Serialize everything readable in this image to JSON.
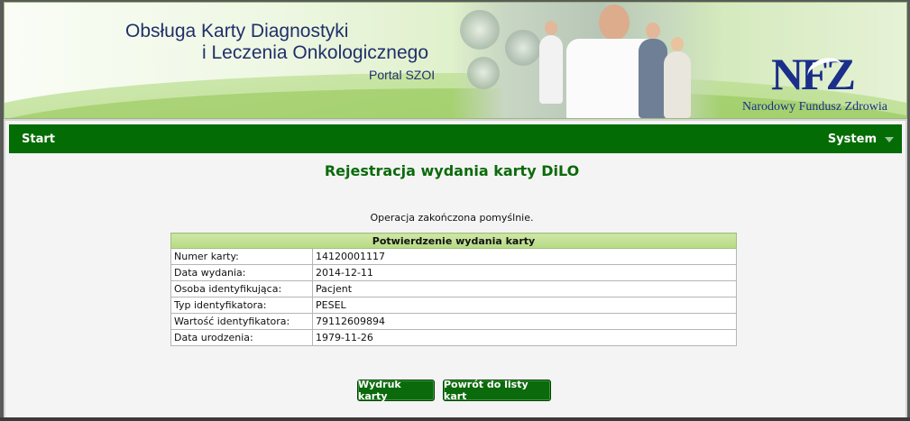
{
  "header": {
    "title_line1": "Obsługa Karty Diagnostyki",
    "title_line2": "i Leczenia Onkologicznego",
    "portal_label": "Portal SZOI",
    "logo_text": "NFZ",
    "org_name": "Narodowy Fundusz Zdrowia"
  },
  "nav": {
    "start_label": "Start",
    "system_label": "System",
    "system_icon": "caret-down-icon"
  },
  "main": {
    "title": "Rejestracja wydania karty DiLO",
    "status_message": "Operacja zakończona pomyślnie.",
    "table": {
      "header": "Potwierdzenie wydania karty",
      "rows": [
        {
          "label": "Numer karty:",
          "value": "14120001117"
        },
        {
          "label": "Data wydania:",
          "value": "2014-12-11"
        },
        {
          "label": "Osoba identyfikująca:",
          "value": "Pacjent"
        },
        {
          "label": "Typ identyfikatora:",
          "value": "PESEL"
        },
        {
          "label": "Wartość identyfikatora:",
          "value": "79112609894"
        },
        {
          "label": "Data urodzenia:",
          "value": "1979-11-26"
        }
      ]
    },
    "buttons": {
      "print_label": "Wydruk karty",
      "back_label": "Powrót do listy kart"
    }
  },
  "colors": {
    "nav_bg": "#046c04",
    "title_green": "#0b6a0b",
    "table_header_bg": "#b6da84",
    "brand_blue": "#1a2e8a"
  }
}
